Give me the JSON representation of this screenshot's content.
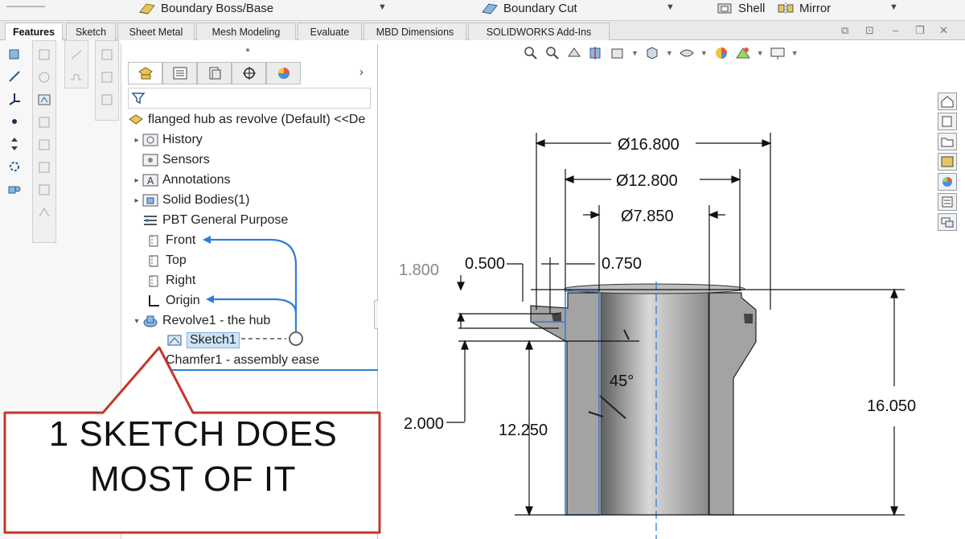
{
  "command_bar": {
    "boundary_boss": "Boundary Boss/Base",
    "boundary_cut": "Boundary Cut",
    "shell": "Shell",
    "mirror": "Mirror"
  },
  "tabs": [
    {
      "label": "Features",
      "active": true
    },
    {
      "label": "Sketch"
    },
    {
      "label": "Sheet Metal"
    },
    {
      "label": "Mesh Modeling"
    },
    {
      "label": "Evaluate"
    },
    {
      "label": "MBD Dimensions"
    },
    {
      "label": "SOLIDWORKS Add-Ins"
    }
  ],
  "feature_tree": {
    "root": "flanged hub as revolve (Default) <<De",
    "items": [
      {
        "label": "History"
      },
      {
        "label": "Sensors"
      },
      {
        "label": "Annotations"
      },
      {
        "label": "Solid Bodies(1)"
      },
      {
        "label": "PBT General Purpose"
      },
      {
        "label": "Front"
      },
      {
        "label": "Top"
      },
      {
        "label": "Right"
      },
      {
        "label": "Origin"
      },
      {
        "label": "Revolve1 - the hub"
      },
      {
        "label": "Sketch1"
      },
      {
        "label": "Chamfer1 - assembly ease"
      }
    ]
  },
  "dimensions": {
    "d1": "Ø16.800",
    "d2": "Ø12.800",
    "d3": "Ø7.850",
    "h_1800": "1.800",
    "w_0500": "0.500",
    "w_0750": "0.750",
    "h_2000": "2.000",
    "h_12250": "12.250",
    "h_16050": "16.050",
    "angle": "45°"
  },
  "callout": {
    "line1": "1 SKETCH DOES",
    "line2": "MOST OF IT"
  },
  "colors": {
    "sketch_blue": "#2f7dd6",
    "callout_red": "#c0392b",
    "part_grey": "#9c9c9c"
  }
}
